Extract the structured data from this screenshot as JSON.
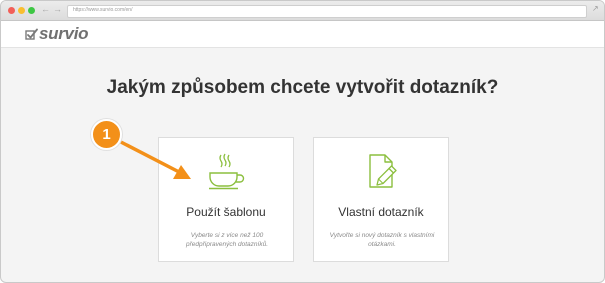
{
  "browser": {
    "url": "https://www.survio.com/en/",
    "back_glyph": "←",
    "forward_glyph": "→",
    "expand_glyph": "↗"
  },
  "app": {
    "logo_text": "survio"
  },
  "page": {
    "heading": "Jakým způsobem chcete vytvořit dotazník?"
  },
  "callout": {
    "number": "1"
  },
  "options": [
    {
      "title": "Použít šablonu",
      "description": "Vyberte si z více než 100 předpřipravených dotazníků.",
      "icon": "coffee-cup-icon"
    },
    {
      "title": "Vlastní dotazník",
      "description": "Vytvořte si nový dotazník s vlastními otázkami.",
      "icon": "document-pencil-icon"
    }
  ],
  "colors": {
    "accent_green": "#8cbf3f",
    "callout_orange": "#f39019",
    "heading": "#333333"
  }
}
